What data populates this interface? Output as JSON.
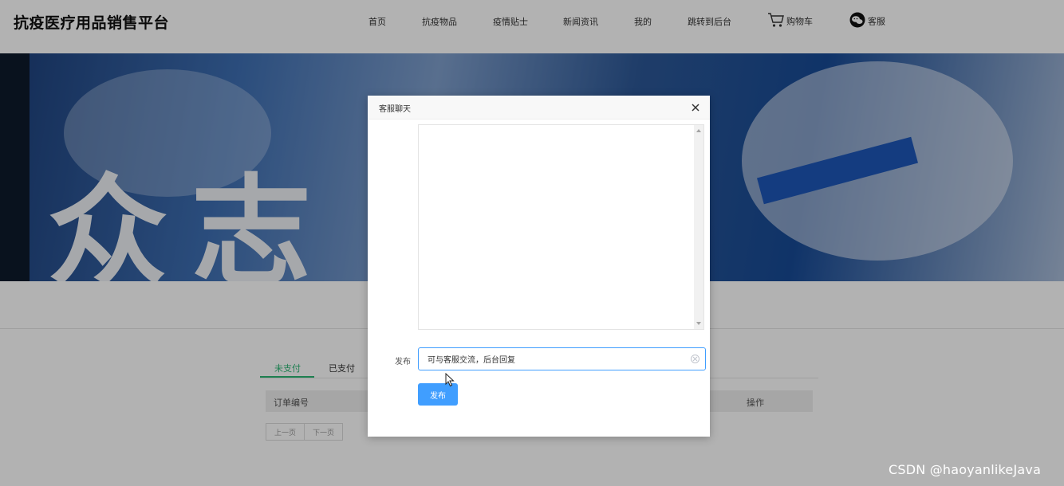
{
  "header": {
    "logo": "抗疫医疗用品销售平台",
    "nav": [
      "首页",
      "抗疫物品",
      "疫情贴士",
      "新闻资讯",
      "我的",
      "跳转到后台"
    ],
    "cart_label": "购物车",
    "service_label": "客服"
  },
  "banner": {
    "text": "众志"
  },
  "orders": {
    "tabs": [
      "未支付",
      "已支付"
    ],
    "active_tab": "未支付",
    "columns": [
      "订单编号",
      "操作"
    ],
    "pager": [
      "上一页",
      "下一页"
    ]
  },
  "dialog": {
    "title": "客服聊天",
    "field_label": "发布",
    "input_value": "可与客服交流，后台回复",
    "submit_label": "发布"
  },
  "watermark": "CSDN @haoyanlikeJava",
  "colors": {
    "primary": "#409eff",
    "active_tab": "#2bb673",
    "overlay": "rgba(0,0,0,0.30)"
  },
  "icons": {
    "cart": "cart-icon",
    "service": "wechat-icon",
    "close": "close-icon",
    "clear": "clear-icon"
  }
}
